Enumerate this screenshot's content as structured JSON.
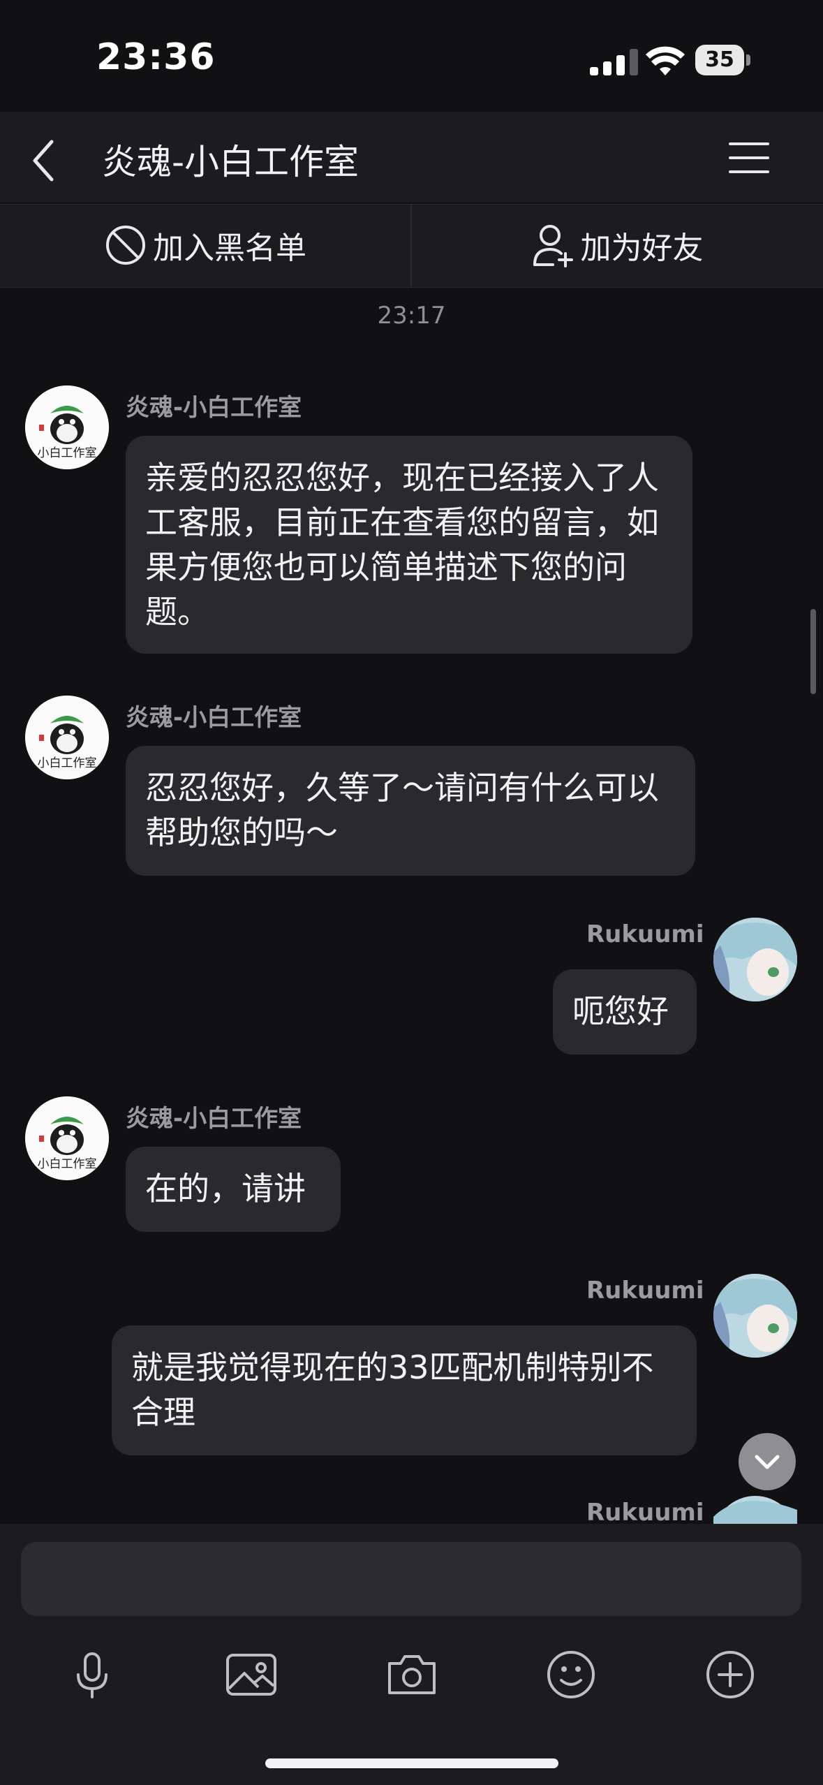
{
  "status": {
    "time": "23:36",
    "battery": "35"
  },
  "header": {
    "title": "炎魂-小白工作室"
  },
  "actions": {
    "blacklist": "加入黑名单",
    "add_friend": "加为好友"
  },
  "chat": {
    "timestamp": "23:17",
    "messages": [
      {
        "sender": "炎魂-小白工作室",
        "text": "亲爱的忍忍您好，现在已经接入了人工客服，目前正在查看您的留言，如果方便您也可以简单描述下您的问题。"
      },
      {
        "sender": "炎魂-小白工作室",
        "text": "忍忍您好，久等了～请问有什么可以帮助您的吗～"
      },
      {
        "sender": "Rukuumi",
        "text": "呃您好"
      },
      {
        "sender": "炎魂-小白工作室",
        "text": "在的，请讲"
      },
      {
        "sender": "Rukuumi",
        "text": "就是我觉得现在的33匹配机制特别不合理"
      },
      {
        "sender": "Rukuumi",
        "text": ""
      }
    ]
  },
  "avatars": {
    "studio": "小白工作室"
  },
  "input": {
    "placeholder": ""
  }
}
